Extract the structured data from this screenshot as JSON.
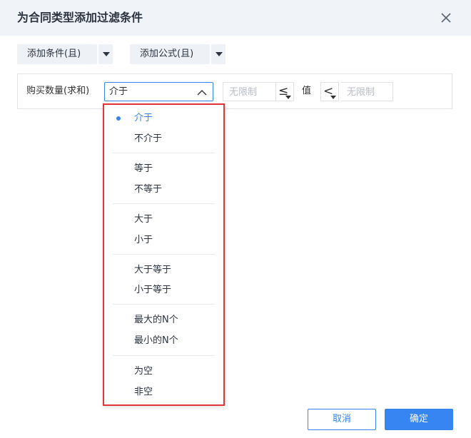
{
  "dialog": {
    "title": "为合同类型添加过滤条件",
    "close_icon": "close-icon"
  },
  "toolbar": {
    "add_condition_label": "添加条件(且)",
    "add_formula_label": "添加公式(且)"
  },
  "condition": {
    "field_label": "购买数量(求和)",
    "operator_value": "介于",
    "min_placeholder": "无限制",
    "min_compare": "≤",
    "value_label": "值",
    "max_compare": "<",
    "max_placeholder": "无限制"
  },
  "operator_menu": {
    "selected": "介于",
    "groups": [
      [
        "介于",
        "不介于"
      ],
      [
        "等于",
        "不等于"
      ],
      [
        "大于",
        "小于"
      ],
      [
        "大于等于",
        "小于等于"
      ],
      [
        "最大的N个",
        "最小的N个"
      ],
      [
        "为空",
        "非空"
      ]
    ]
  },
  "footer": {
    "cancel_label": "取消",
    "ok_label": "确定"
  },
  "colors": {
    "accent": "#3685f2",
    "highlight_border": "#e2353a",
    "header_bg": "#f0f3f7"
  }
}
